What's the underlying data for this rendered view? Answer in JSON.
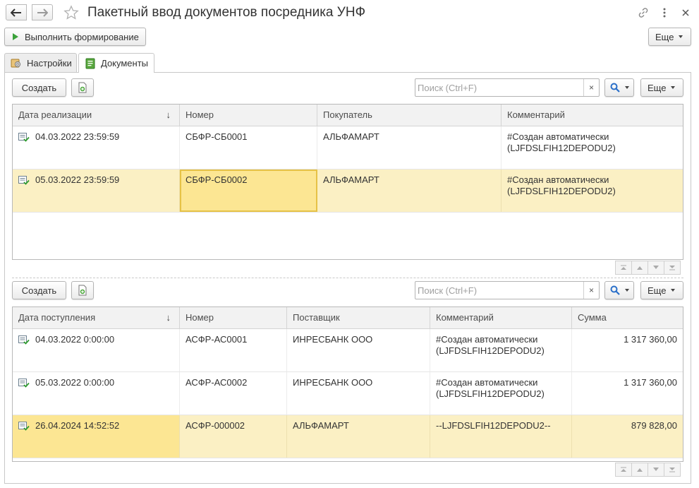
{
  "window": {
    "title": "Пакетный ввод документов посредника УНФ"
  },
  "toolbar": {
    "run_label": "Выполнить формирование",
    "more_label": "Еще"
  },
  "tabs": [
    {
      "label": "Настройки"
    },
    {
      "label": "Документы"
    }
  ],
  "sales_section": {
    "create_label": "Создать",
    "search_placeholder": "Поиск (Ctrl+F)",
    "search_clear": "×",
    "more_label": "Еще",
    "columns": [
      "Дата реализации",
      "Номер",
      "Покупатель",
      "Комментарий"
    ],
    "sort_indicator": "↓",
    "rows": [
      {
        "date": "04.03.2022 23:59:59",
        "number": "СБФР-СБ0001",
        "buyer": "АЛЬФАМАРТ",
        "comment_line1": "#Создан автоматически",
        "comment_line2": "(LJFDSLFIH12DEPODU2)"
      },
      {
        "date": "05.03.2022 23:59:59",
        "number": "СБФР-СБ0002",
        "buyer": "АЛЬФАМАРТ",
        "comment_line1": "#Создан автоматически",
        "comment_line2": "(LJFDSLFIH12DEPODU2)"
      }
    ]
  },
  "receipts_section": {
    "create_label": "Создать",
    "search_placeholder": "Поиск (Ctrl+F)",
    "search_clear": "×",
    "more_label": "Еще",
    "columns": [
      "Дата поступления",
      "Номер",
      "Поставщик",
      "Комментарий",
      "Сумма"
    ],
    "sort_indicator": "↓",
    "rows": [
      {
        "date": "04.03.2022 0:00:00",
        "number": "АСФР-АС0001",
        "supplier": "ИНРЕСБАНК ООО",
        "comment_line1": "#Создан автоматически",
        "comment_line2": "(LJFDSLFIH12DEPODU2)",
        "sum": "1 317 360,00"
      },
      {
        "date": "05.03.2022 0:00:00",
        "number": "АСФР-АС0002",
        "supplier": "ИНРЕСБАНК ООО",
        "comment_line1": "#Создан автоматически",
        "comment_line2": "(LJFDSLFIH12DEPODU2)",
        "sum": "1 317 360,00"
      },
      {
        "date": "26.04.2024 14:52:52",
        "number": "АСФР-000002",
        "supplier": "АЛЬФАМАРТ",
        "comment_line1": "--LJFDSLFIH12DEPODU2--",
        "comment_line2": "",
        "sum": "879 828,00"
      }
    ]
  },
  "colors": {
    "selected_row": "#fbf0c4",
    "focused_cell": "#fce693",
    "run_icon": "#3aa23a",
    "search_icon": "#2a6fc9"
  },
  "icons": [
    "back-arrow-icon",
    "forward-arrow-icon",
    "star-icon",
    "link-icon",
    "more-vertical-icon",
    "close-icon",
    "play-icon",
    "settings-tab-icon",
    "documents-tab-icon",
    "copy-document-icon",
    "search-icon",
    "document-posted-icon",
    "scroll-first-icon",
    "scroll-up-icon",
    "scroll-down-icon",
    "scroll-last-icon"
  ]
}
